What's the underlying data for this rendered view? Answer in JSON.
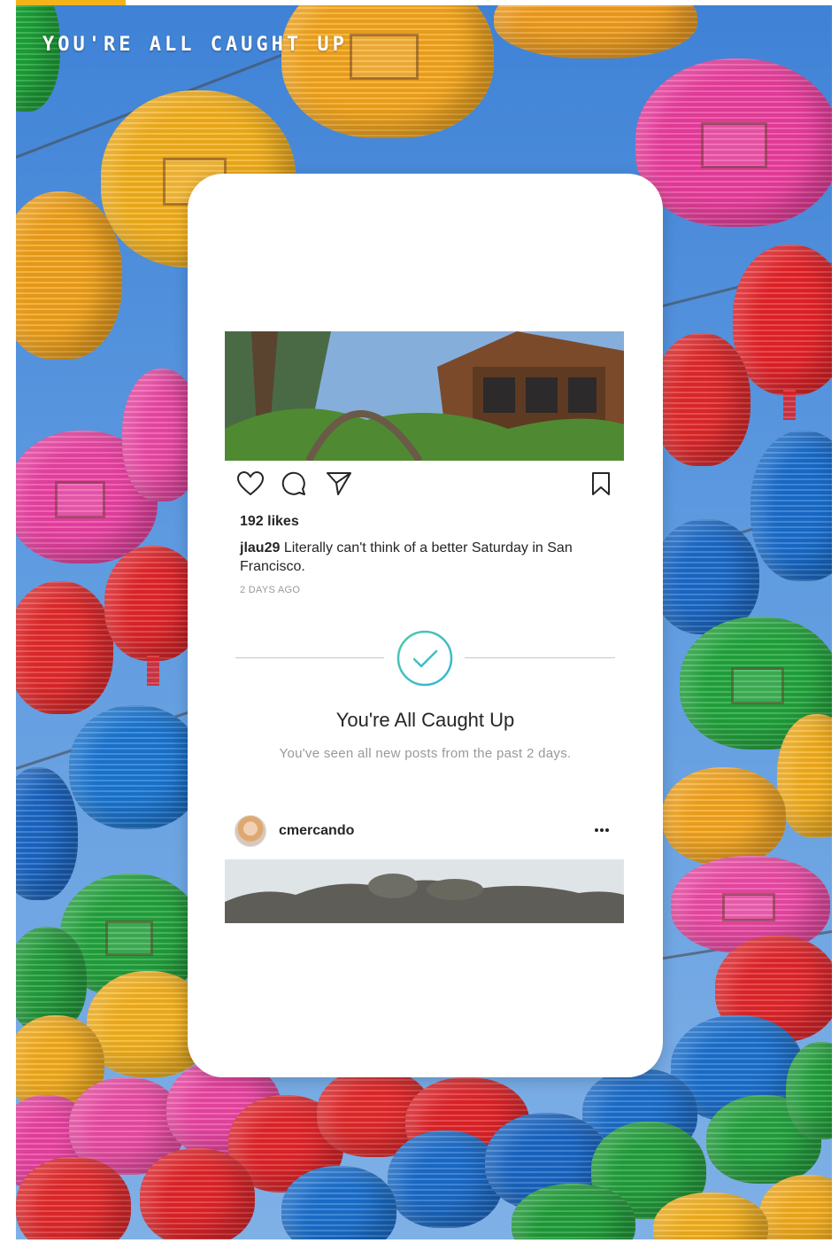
{
  "banner": {
    "title": "YOU'RE ALL CAUGHT UP"
  },
  "post": {
    "likes": "192 likes",
    "username": "jlau29",
    "caption": "Literally can't think of a better Saturday in San Francisco.",
    "timestamp": "2 DAYS AGO"
  },
  "caught_up": {
    "title": "You're All Caught Up",
    "subtitle": "You've seen all new posts from the past 2 days."
  },
  "next_post": {
    "username": "cmercando",
    "more_label": "•••"
  },
  "icons": [
    "like-icon",
    "comment-icon",
    "share-icon",
    "save-icon",
    "check-icon",
    "more-icon"
  ],
  "colors": {
    "check_gradient_start": "#4cc9a8",
    "check_gradient_end": "#38b4d8",
    "accent": "#f2b418",
    "text": "#262626",
    "muted": "#999999"
  }
}
